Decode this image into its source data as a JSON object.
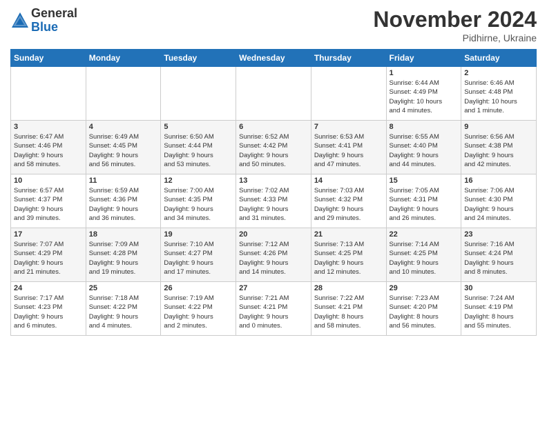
{
  "header": {
    "logo_line1": "General",
    "logo_line2": "Blue",
    "month_title": "November 2024",
    "location": "Pidhirne, Ukraine"
  },
  "days_of_week": [
    "Sunday",
    "Monday",
    "Tuesday",
    "Wednesday",
    "Thursday",
    "Friday",
    "Saturday"
  ],
  "weeks": [
    [
      {
        "day": "",
        "info": ""
      },
      {
        "day": "",
        "info": ""
      },
      {
        "day": "",
        "info": ""
      },
      {
        "day": "",
        "info": ""
      },
      {
        "day": "",
        "info": ""
      },
      {
        "day": "1",
        "info": "Sunrise: 6:44 AM\nSunset: 4:49 PM\nDaylight: 10 hours\nand 4 minutes."
      },
      {
        "day": "2",
        "info": "Sunrise: 6:46 AM\nSunset: 4:48 PM\nDaylight: 10 hours\nand 1 minute."
      }
    ],
    [
      {
        "day": "3",
        "info": "Sunrise: 6:47 AM\nSunset: 4:46 PM\nDaylight: 9 hours\nand 58 minutes."
      },
      {
        "day": "4",
        "info": "Sunrise: 6:49 AM\nSunset: 4:45 PM\nDaylight: 9 hours\nand 56 minutes."
      },
      {
        "day": "5",
        "info": "Sunrise: 6:50 AM\nSunset: 4:44 PM\nDaylight: 9 hours\nand 53 minutes."
      },
      {
        "day": "6",
        "info": "Sunrise: 6:52 AM\nSunset: 4:42 PM\nDaylight: 9 hours\nand 50 minutes."
      },
      {
        "day": "7",
        "info": "Sunrise: 6:53 AM\nSunset: 4:41 PM\nDaylight: 9 hours\nand 47 minutes."
      },
      {
        "day": "8",
        "info": "Sunrise: 6:55 AM\nSunset: 4:40 PM\nDaylight: 9 hours\nand 44 minutes."
      },
      {
        "day": "9",
        "info": "Sunrise: 6:56 AM\nSunset: 4:38 PM\nDaylight: 9 hours\nand 42 minutes."
      }
    ],
    [
      {
        "day": "10",
        "info": "Sunrise: 6:57 AM\nSunset: 4:37 PM\nDaylight: 9 hours\nand 39 minutes."
      },
      {
        "day": "11",
        "info": "Sunrise: 6:59 AM\nSunset: 4:36 PM\nDaylight: 9 hours\nand 36 minutes."
      },
      {
        "day": "12",
        "info": "Sunrise: 7:00 AM\nSunset: 4:35 PM\nDaylight: 9 hours\nand 34 minutes."
      },
      {
        "day": "13",
        "info": "Sunrise: 7:02 AM\nSunset: 4:33 PM\nDaylight: 9 hours\nand 31 minutes."
      },
      {
        "day": "14",
        "info": "Sunrise: 7:03 AM\nSunset: 4:32 PM\nDaylight: 9 hours\nand 29 minutes."
      },
      {
        "day": "15",
        "info": "Sunrise: 7:05 AM\nSunset: 4:31 PM\nDaylight: 9 hours\nand 26 minutes."
      },
      {
        "day": "16",
        "info": "Sunrise: 7:06 AM\nSunset: 4:30 PM\nDaylight: 9 hours\nand 24 minutes."
      }
    ],
    [
      {
        "day": "17",
        "info": "Sunrise: 7:07 AM\nSunset: 4:29 PM\nDaylight: 9 hours\nand 21 minutes."
      },
      {
        "day": "18",
        "info": "Sunrise: 7:09 AM\nSunset: 4:28 PM\nDaylight: 9 hours\nand 19 minutes."
      },
      {
        "day": "19",
        "info": "Sunrise: 7:10 AM\nSunset: 4:27 PM\nDaylight: 9 hours\nand 17 minutes."
      },
      {
        "day": "20",
        "info": "Sunrise: 7:12 AM\nSunset: 4:26 PM\nDaylight: 9 hours\nand 14 minutes."
      },
      {
        "day": "21",
        "info": "Sunrise: 7:13 AM\nSunset: 4:25 PM\nDaylight: 9 hours\nand 12 minutes."
      },
      {
        "day": "22",
        "info": "Sunrise: 7:14 AM\nSunset: 4:25 PM\nDaylight: 9 hours\nand 10 minutes."
      },
      {
        "day": "23",
        "info": "Sunrise: 7:16 AM\nSunset: 4:24 PM\nDaylight: 9 hours\nand 8 minutes."
      }
    ],
    [
      {
        "day": "24",
        "info": "Sunrise: 7:17 AM\nSunset: 4:23 PM\nDaylight: 9 hours\nand 6 minutes."
      },
      {
        "day": "25",
        "info": "Sunrise: 7:18 AM\nSunset: 4:22 PM\nDaylight: 9 hours\nand 4 minutes."
      },
      {
        "day": "26",
        "info": "Sunrise: 7:19 AM\nSunset: 4:22 PM\nDaylight: 9 hours\nand 2 minutes."
      },
      {
        "day": "27",
        "info": "Sunrise: 7:21 AM\nSunset: 4:21 PM\nDaylight: 9 hours\nand 0 minutes."
      },
      {
        "day": "28",
        "info": "Sunrise: 7:22 AM\nSunset: 4:21 PM\nDaylight: 8 hours\nand 58 minutes."
      },
      {
        "day": "29",
        "info": "Sunrise: 7:23 AM\nSunset: 4:20 PM\nDaylight: 8 hours\nand 56 minutes."
      },
      {
        "day": "30",
        "info": "Sunrise: 7:24 AM\nSunset: 4:19 PM\nDaylight: 8 hours\nand 55 minutes."
      }
    ]
  ]
}
